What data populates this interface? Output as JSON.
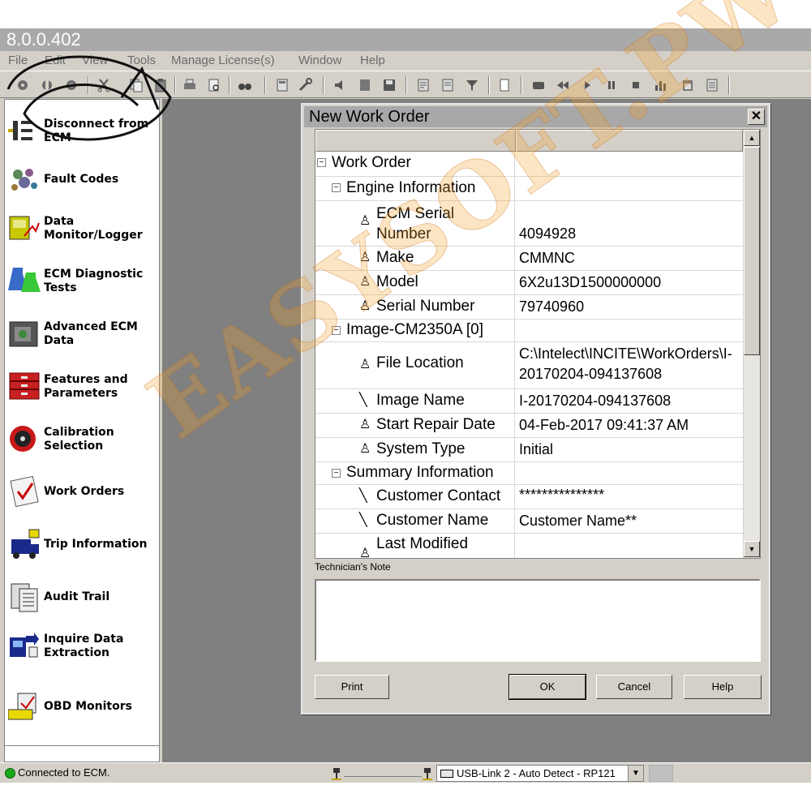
{
  "window": {
    "title": "8.0.0.402"
  },
  "menu": [
    "File",
    "Edit",
    "View",
    "Tools",
    "Manage License(s)",
    "Window",
    "Help"
  ],
  "sidebar": {
    "items": [
      {
        "label": "Disconnect from ECM",
        "icon": "disconnect-icon"
      },
      {
        "label": "Fault Codes",
        "icon": "fault-codes-icon"
      },
      {
        "label": "Data Monitor/Logger",
        "icon": "data-monitor-icon"
      },
      {
        "label": "ECM Diagnostic Tests",
        "icon": "diagnostic-tests-icon"
      },
      {
        "label": "Advanced ECM Data",
        "icon": "advanced-ecm-icon"
      },
      {
        "label": "Features and Parameters",
        "icon": "features-icon"
      },
      {
        "label": "Calibration Selection",
        "icon": "calibration-icon"
      },
      {
        "label": "Work Orders",
        "icon": "work-orders-icon"
      },
      {
        "label": "Trip Information",
        "icon": "trip-icon"
      },
      {
        "label": "Audit Trail",
        "icon": "audit-icon"
      },
      {
        "label": "Inquire Data Extraction",
        "icon": "inquire-icon"
      },
      {
        "label": "OBD Monitors",
        "icon": "obd-icon"
      }
    ]
  },
  "dialog": {
    "title": "New Work Order",
    "close_label": "✕",
    "tree": [
      {
        "name": "Work Order",
        "value": ""
      },
      {
        "name": "Engine Information",
        "value": ""
      },
      {
        "name": "ECM Serial Number",
        "value": "4094928"
      },
      {
        "name": "Make",
        "value": "CMMNC"
      },
      {
        "name": "Model",
        "value": "6X2u13D1500000000"
      },
      {
        "name": "Serial Number",
        "value": "79740960"
      },
      {
        "name": "Image-CM2350A [0]",
        "value": ""
      },
      {
        "name": "File Location",
        "value": "C:\\Intelect\\INCITE\\WorkOrders\\I-20170204-094137608"
      },
      {
        "name": "Image Name",
        "value": "I-20170204-094137608"
      },
      {
        "name": "Start Repair Date",
        "value": "04-Feb-2017 09:41:37 AM"
      },
      {
        "name": "System Type",
        "value": "Initial"
      },
      {
        "name": "Summary Information",
        "value": ""
      },
      {
        "name": "Customer Contact",
        "value": "***************"
      },
      {
        "name": "Customer Name",
        "value": "Customer Name**"
      },
      {
        "name": "Last Modified",
        "value": ""
      }
    ],
    "tech_note_label": "Technician's Note",
    "tech_note_value": "",
    "buttons": {
      "print": "Print",
      "ok": "OK",
      "cancel": "Cancel",
      "help": "Help"
    }
  },
  "status": {
    "text": "Connected to ECM.",
    "adapter": "USB-Link 2 - Auto Detect - RP121"
  },
  "watermark": "EASYSOFT.PW"
}
